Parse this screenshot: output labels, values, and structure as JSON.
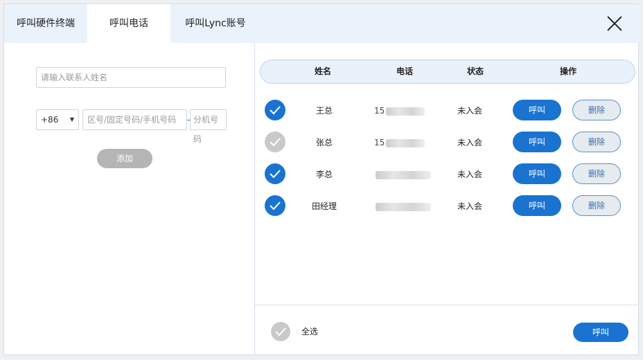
{
  "tabs": [
    {
      "label": "呼叫硬件终端",
      "active": false
    },
    {
      "label": "呼叫电话",
      "active": true
    },
    {
      "label": "呼叫Lync账号",
      "active": false
    }
  ],
  "form": {
    "name_placeholder": "请输入联系人姓名",
    "country_code": "+86",
    "phone_placeholder": "区号/固定号码/手机号码",
    "separator": "-",
    "ext_placeholder": "分机号码",
    "add_label": "添加"
  },
  "table": {
    "headers": [
      "姓名",
      "电话",
      "状态",
      "操作"
    ],
    "rows": [
      {
        "name": "王总",
        "phone_prefix": "15",
        "status": "未入会",
        "checked": true
      },
      {
        "name": "张总",
        "phone_prefix": "15",
        "status": "未入会",
        "checked": false
      },
      {
        "name": "李总",
        "phone_prefix": "",
        "status": "未入会",
        "checked": true
      },
      {
        "name": "田经理",
        "phone_prefix": "",
        "status": "未入会",
        "checked": true
      }
    ],
    "call_label": "呼叫",
    "delete_label": "删除"
  },
  "footer": {
    "select_all_label": "全选",
    "call_label": "呼叫"
  },
  "colors": {
    "accent": "#1a73d1",
    "disabled": "#b5b5b5",
    "header_bg": "#eaf2fb"
  }
}
